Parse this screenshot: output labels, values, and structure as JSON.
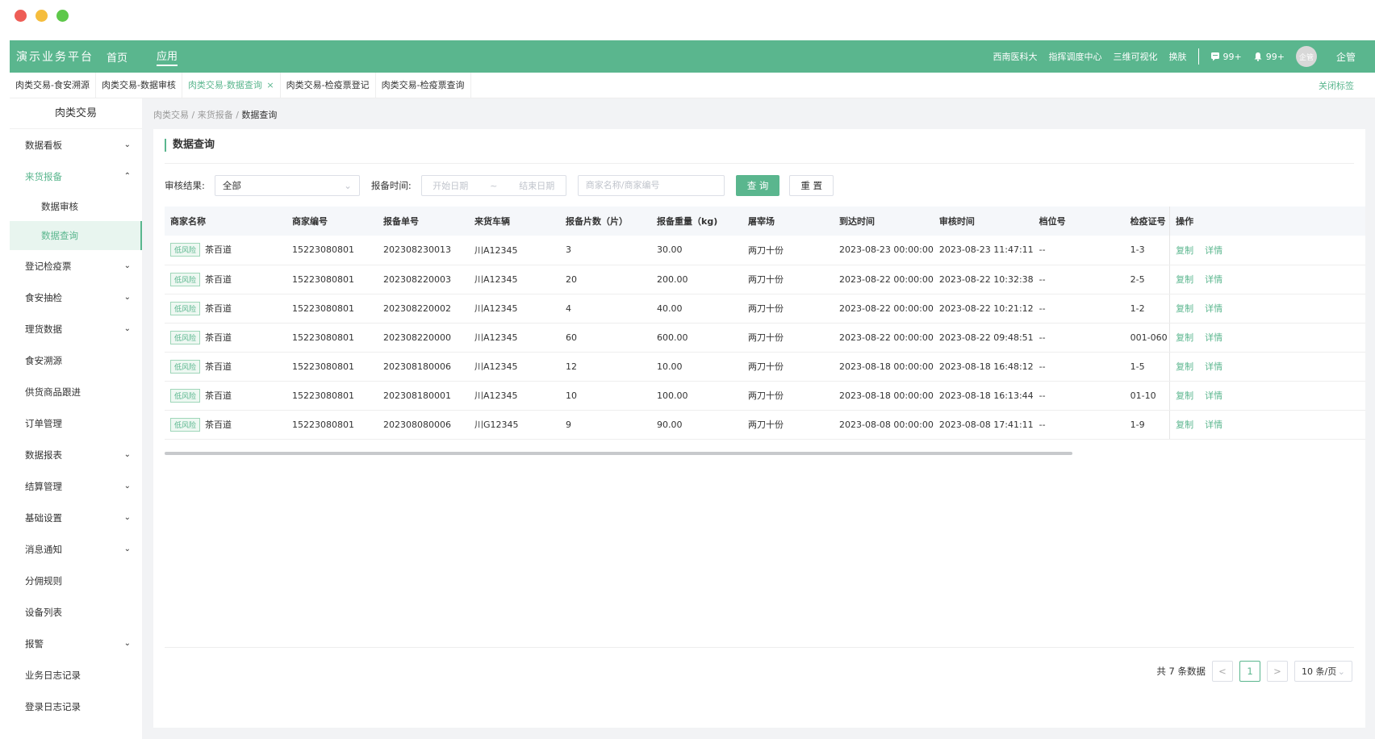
{
  "window": {
    "dot_colors": [
      "#ee5d56",
      "#f5bd3d",
      "#5ec84a"
    ]
  },
  "topbar": {
    "brand": "演示业务平台",
    "nav": [
      "首页",
      "应用"
    ],
    "links": [
      "西南医科大",
      "指挥调度中心",
      "三维可视化",
      "换肤"
    ],
    "msg_count": "99+",
    "bell_count": "99+",
    "avatar_text": "企管",
    "user": "企管"
  },
  "tabs": [
    "肉类交易-食安溯源",
    "肉类交易-数据审核",
    "肉类交易-数据查询",
    "肉类交易-检疫票登记",
    "肉类交易-检疫票查询"
  ],
  "tabs_close_label": "关闭标签",
  "sidebar": {
    "title": "肉类交易",
    "items": [
      {
        "label": "数据看板",
        "chevron": "⌄"
      },
      {
        "label": "来货报备",
        "chevron": "⌃"
      },
      {
        "label": "数据审核",
        "chevron": ""
      },
      {
        "label": "数据查询",
        "chevron": ""
      },
      {
        "label": "登记检疫票",
        "chevron": "⌄"
      },
      {
        "label": "食安抽检",
        "chevron": "⌄"
      },
      {
        "label": "理货数据",
        "chevron": "⌄"
      },
      {
        "label": "食安溯源",
        "chevron": ""
      },
      {
        "label": "供货商品跟进",
        "chevron": ""
      },
      {
        "label": "订单管理",
        "chevron": ""
      },
      {
        "label": "数据报表",
        "chevron": "⌄"
      },
      {
        "label": "结算管理",
        "chevron": "⌄"
      },
      {
        "label": "基础设置",
        "chevron": "⌄"
      },
      {
        "label": "消息通知",
        "chevron": "⌄"
      },
      {
        "label": "分佣规则",
        "chevron": ""
      },
      {
        "label": "设备列表",
        "chevron": ""
      },
      {
        "label": "报警",
        "chevron": "⌄"
      },
      {
        "label": "业务日志记录",
        "chevron": ""
      },
      {
        "label": "登录日志记录",
        "chevron": ""
      }
    ]
  },
  "breadcrumb": [
    "肉类交易",
    "来货报备",
    "数据查询"
  ],
  "panel_title": "数据查询",
  "filters": {
    "audit_label": "审核结果:",
    "audit_value": "全部",
    "time_label": "报备时间:",
    "start_placeholder": "开始日期",
    "range_sep": "~",
    "end_placeholder": "结束日期",
    "keyword_placeholder": "商家名称/商家编号",
    "query_button": "查 询",
    "reset_button": "重 置"
  },
  "table": {
    "headers": [
      "商家名称",
      "商家编号",
      "报备单号",
      "来货车辆",
      "报备片数（片）",
      "报备重量（kg)",
      "屠宰场",
      "到达时间",
      "审核时间",
      "档位号",
      "检疫证号",
      "操作"
    ],
    "risk_label": "低风险",
    "op_copy": "复制",
    "op_detail": "详情",
    "rows": [
      [
        "茶百道",
        "15223080801",
        "202308230013",
        "川A12345",
        "3",
        "30.00",
        "两刀十份",
        "2023-08-23 00:00:00",
        "2023-08-23 11:47:11",
        "--",
        "1-3"
      ],
      [
        "茶百道",
        "15223080801",
        "202308220003",
        "川A12345",
        "20",
        "200.00",
        "两刀十份",
        "2023-08-22 00:00:00",
        "2023-08-22 10:32:38",
        "--",
        "2-5"
      ],
      [
        "茶百道",
        "15223080801",
        "202308220002",
        "川A12345",
        "4",
        "40.00",
        "两刀十份",
        "2023-08-22 00:00:00",
        "2023-08-22 10:21:12",
        "--",
        "1-2"
      ],
      [
        "茶百道",
        "15223080801",
        "202308220000",
        "川A12345",
        "60",
        "600.00",
        "两刀十份",
        "2023-08-22 00:00:00",
        "2023-08-22 09:48:51",
        "--",
        "001-060"
      ],
      [
        "茶百道",
        "15223080801",
        "202308180006",
        "川A12345",
        "12",
        "10.00",
        "两刀十份",
        "2023-08-18 00:00:00",
        "2023-08-18 16:48:12",
        "--",
        "1-5"
      ],
      [
        "茶百道",
        "15223080801",
        "202308180001",
        "川A12345",
        "10",
        "100.00",
        "两刀十份",
        "2023-08-18 00:00:00",
        "2023-08-18 16:13:44",
        "--",
        "01-10"
      ],
      [
        "茶百道",
        "15223080801",
        "202308080006",
        "川G12345",
        "9",
        "90.00",
        "两刀十份",
        "2023-08-08 00:00:00",
        "2023-08-08 17:41:11",
        "--",
        "1-9"
      ]
    ]
  },
  "pager": {
    "total": "共 7 条数据",
    "prev": "<",
    "current_page": "1",
    "next": ">",
    "page_size": "10 条/页"
  },
  "colors": {
    "primary": "#5ab68e"
  }
}
